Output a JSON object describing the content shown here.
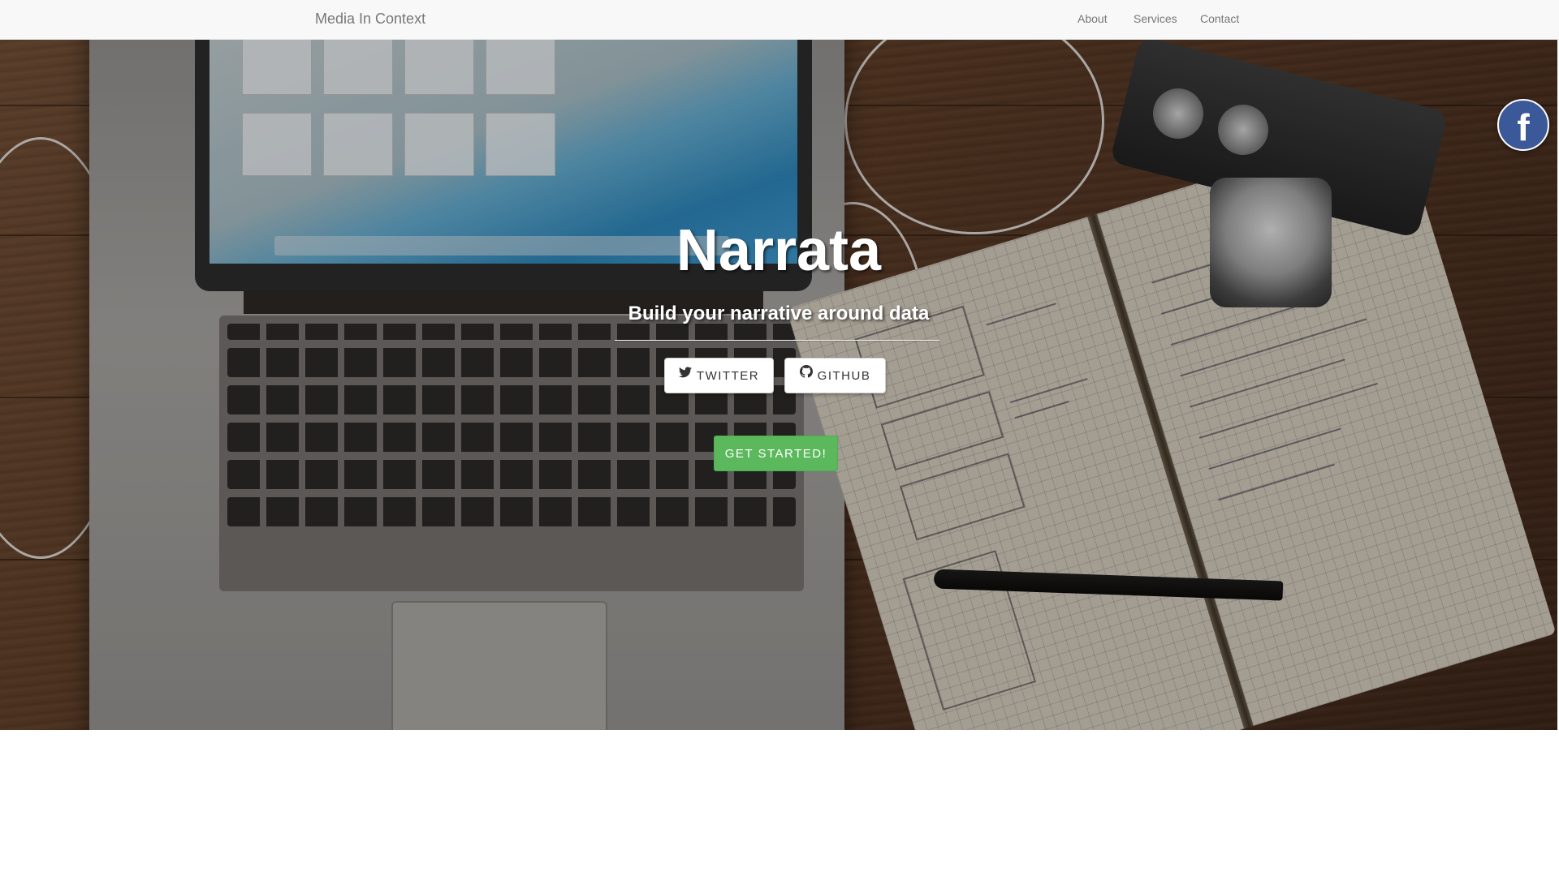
{
  "navbar": {
    "brand": "Media In Context",
    "links": [
      "About",
      "Services",
      "Contact"
    ]
  },
  "hero": {
    "title": "Narrata",
    "subtitle": "Build your narrative around data",
    "buttons": {
      "twitter_label": "TWITTER",
      "github_label": "GITHUB",
      "start_label": "GET STARTED!"
    }
  },
  "social": {
    "facebook_letter": "f"
  },
  "colors": {
    "navbar_bg": "#f8f8f8",
    "nav_text": "#777777",
    "start_button": "#5cb85c",
    "facebook": "#3b5998"
  },
  "icons": {
    "twitter": "twitter-bird-icon",
    "github": "github-octocat-icon",
    "facebook": "facebook-icon"
  }
}
